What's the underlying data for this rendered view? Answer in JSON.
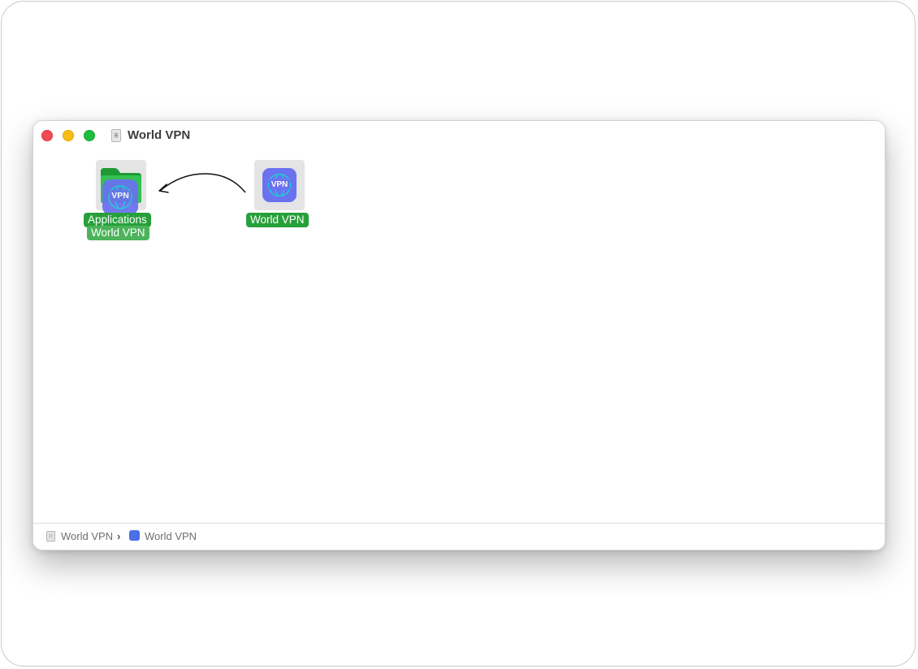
{
  "window": {
    "title": "World VPN",
    "title_icon": "disk-image-icon",
    "traffic_lights": [
      "close",
      "minimize",
      "zoom"
    ],
    "colors": {
      "close": "#f04a55",
      "minimize": "#f7bd16",
      "zoom": "#1fbd3f"
    }
  },
  "content": {
    "applications_folder": {
      "label": "Applications",
      "icon": "folder-icon",
      "dragged_label": "World VPN",
      "dragged_icon_text": "VPN"
    },
    "app": {
      "label": "World VPN",
      "icon": "vpn-app-icon",
      "icon_text": "VPN"
    },
    "arrow": "curved-arrow-icon",
    "label_color": "#27a03a",
    "vpn_color": "#6b72f0"
  },
  "path_bar": {
    "items": [
      {
        "label": "World VPN",
        "icon": "disk-image-icon"
      },
      {
        "label": "World VPN",
        "icon": "vpn-app-icon"
      }
    ],
    "separator": "›"
  }
}
